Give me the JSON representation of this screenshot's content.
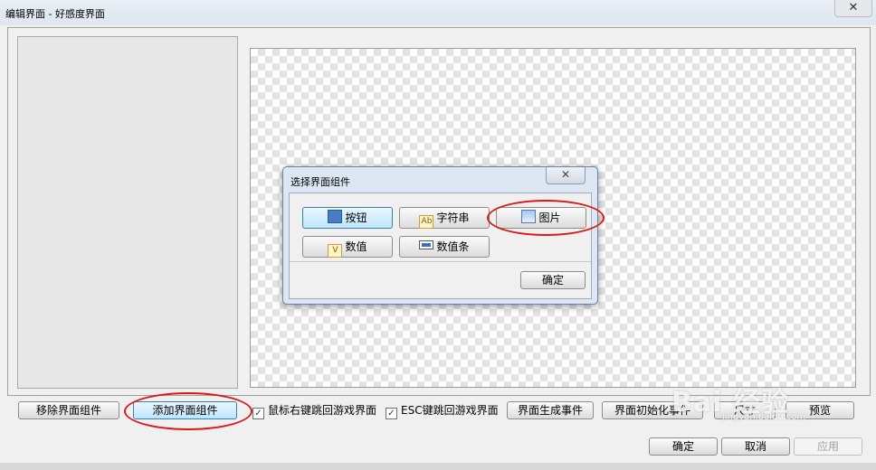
{
  "window": {
    "title": "编辑界面 - 好感度界面",
    "close_glyph": "✕"
  },
  "toolbar": {
    "remove_component": "移除界面组件",
    "add_component": "添加界面组件",
    "checkbox_right_click": {
      "label": "鼠标右键跳回游戏界面",
      "checked": true
    },
    "checkbox_esc": {
      "label": "ESC键跳回游戏界面",
      "checked": true
    },
    "create_event": "界面生成事件",
    "init_event": "界面初始化事件",
    "size_button": "尺寸",
    "preview_button": "预览"
  },
  "footer": {
    "ok": "确定",
    "cancel": "取消",
    "apply": "应用"
  },
  "dialog": {
    "title": "选择界面组件",
    "close_glyph": "✕",
    "buttons": [
      {
        "label": "按钮",
        "icon": "button-icon"
      },
      {
        "label": "字符串",
        "icon": "string-icon",
        "icon_text": "Ab"
      },
      {
        "label": "图片",
        "icon": "image-icon"
      },
      {
        "label": "数值",
        "icon": "number-icon",
        "icon_text": "V"
      },
      {
        "label": "数值条",
        "icon": "progress-bar-icon"
      }
    ],
    "ok": "确定"
  },
  "watermark": {
    "main": "Bai 经验",
    "sub": "jingyan.baidu.com"
  },
  "colors": {
    "highlight_oval": "#d81a1a",
    "accent": "#3c7fb1"
  }
}
